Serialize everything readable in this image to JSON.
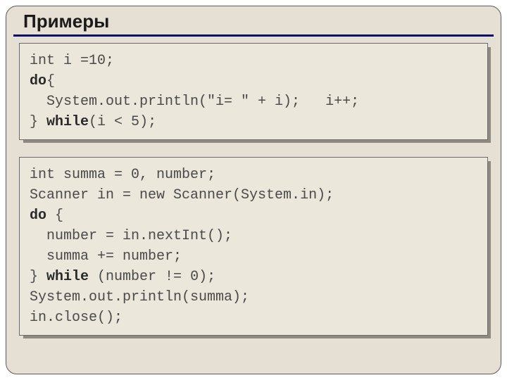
{
  "title": "Примеры",
  "block1": {
    "l1a": "int i =",
    "l1n": "10",
    "l1b": ";",
    "l2a": "do",
    "l2b": "{",
    "l3": "  System.out.println(\"i= \" + i);   i++;",
    "l4a": "} ",
    "l4b": "while",
    "l4c": "(i < ",
    "l4n": "5",
    "l4d": ");"
  },
  "block2": {
    "l1a": "int summa = ",
    "l1n": "0",
    "l1b": ", number;",
    "l2": "Scanner in = new Scanner(System.in);",
    "l3a": "do",
    "l3b": " {",
    "l4": "  number = in.nextInt();",
    "l5": "  summa += number;",
    "l6a": "} ",
    "l6b": "while",
    "l6c": " (number != ",
    "l6n": "0",
    "l6d": ");",
    "l7": "System.out.println(summa);",
    "l8": "in.close();"
  }
}
